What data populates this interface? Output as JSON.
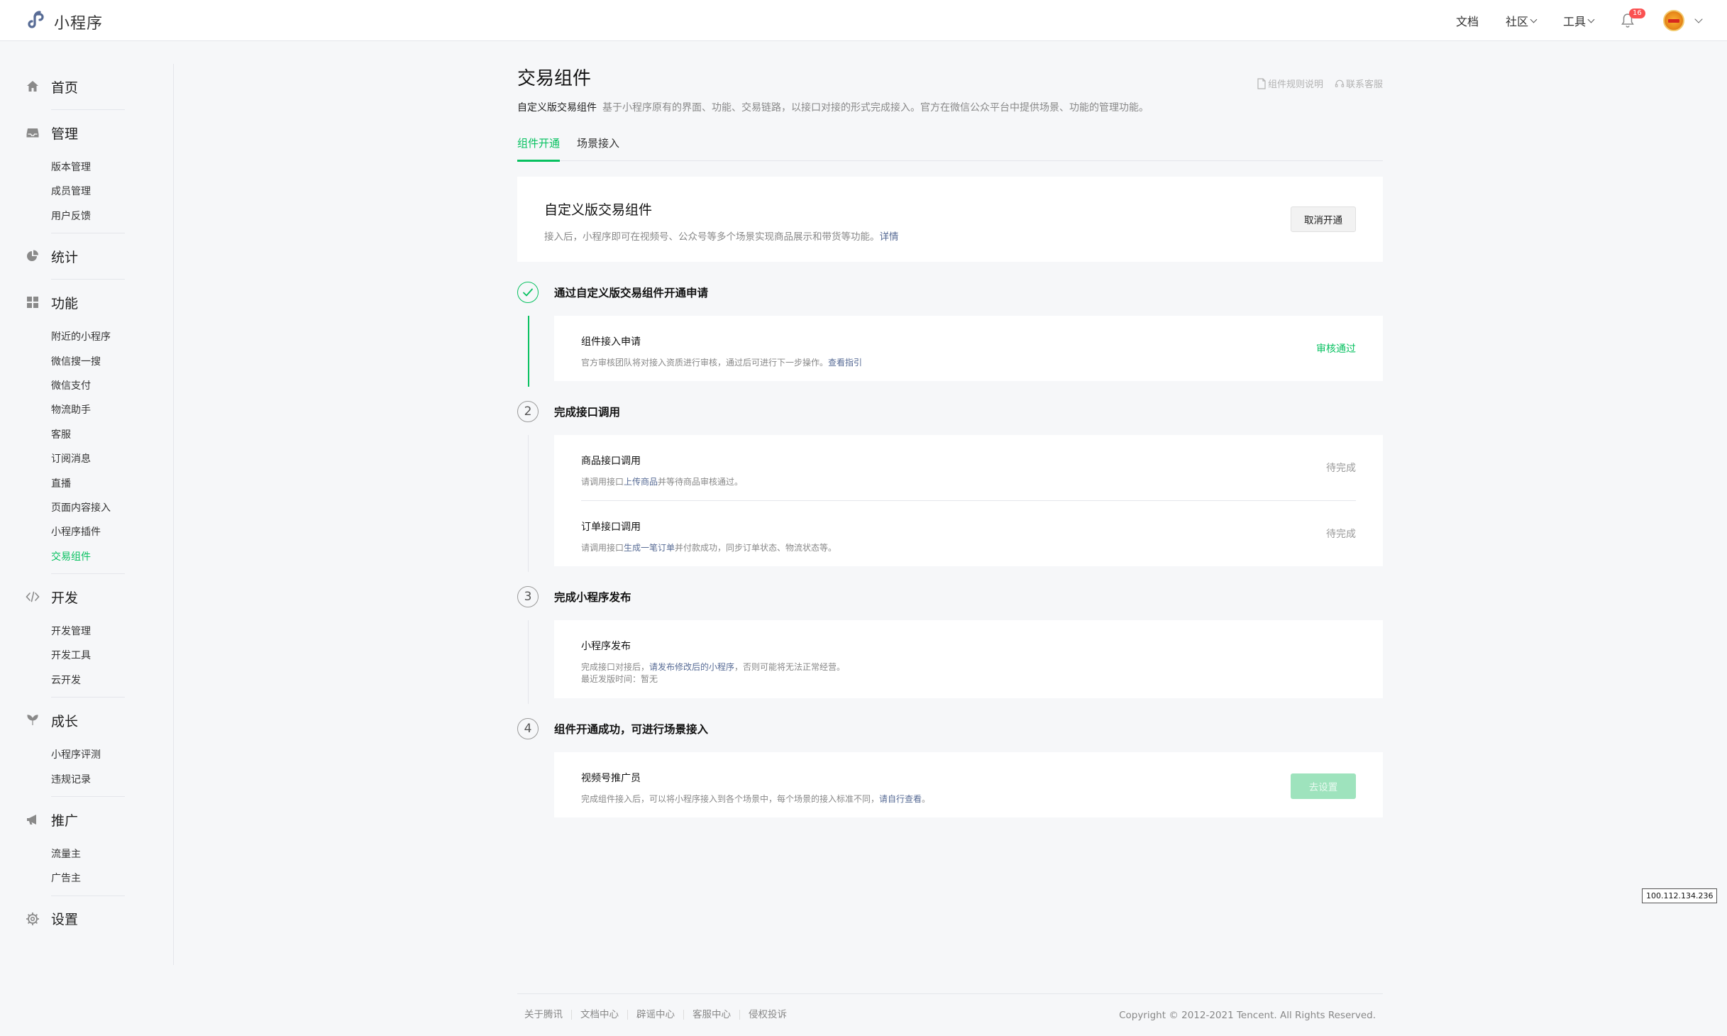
{
  "app": {
    "logo_text": "小程序",
    "brand_color": "#576b95",
    "accent_color": "#07c160"
  },
  "topnav": {
    "docs": "文档",
    "community": "社区",
    "tools": "工具",
    "notification_count": "16",
    "bell_icon": "bell-icon",
    "avatar_icon": "avatar-icon"
  },
  "sidebar": {
    "groups": [
      {
        "label": "首页",
        "icon": "home-icon",
        "items": []
      },
      {
        "label": "管理",
        "icon": "inbox-icon",
        "items": [
          "版本管理",
          "成员管理",
          "用户反馈"
        ]
      },
      {
        "label": "统计",
        "icon": "pie-chart-icon",
        "items": []
      },
      {
        "label": "功能",
        "icon": "grid-icon",
        "items": [
          "附近的小程序",
          "微信搜一搜",
          "微信支付",
          "物流助手",
          "客服",
          "订阅消息",
          "直播",
          "页面内容接入",
          "小程序插件",
          "交易组件"
        ]
      },
      {
        "label": "开发",
        "icon": "code-icon",
        "items": [
          "开发管理",
          "开发工具",
          "云开发"
        ]
      },
      {
        "label": "成长",
        "icon": "leaf-icon",
        "items": [
          "小程序评测",
          "违规记录"
        ]
      },
      {
        "label": "推广",
        "icon": "megaphone-icon",
        "items": [
          "流量主",
          "广告主"
        ]
      },
      {
        "label": "设置",
        "icon": "gear-icon",
        "items": []
      }
    ],
    "active_item": "交易组件"
  },
  "main": {
    "title": "交易组件",
    "links": {
      "rules": "组件规则说明",
      "support": "联系客服"
    },
    "subtitle_bold": "自定义版交易组件",
    "subtitle_text": "基于小程序原有的界面、功能、交易链路，以接口对接的形式完成接入。官方在微信公众平台中提供场景、功能的管理功能。",
    "tabs": [
      {
        "label": "组件开通",
        "active": true
      },
      {
        "label": "场景接入",
        "active": false
      }
    ],
    "hero": {
      "title": "自定义版交易组件",
      "desc": "接入后，小程序即可在视频号、公众号等多个场景实现商品展示和带货等功能。",
      "detail_link": "详情",
      "cancel_button": "取消开通"
    },
    "steps": [
      {
        "num": "1",
        "done": true,
        "title": "通过自定义版交易组件开通申请",
        "rows": [
          {
            "title": "组件接入申请",
            "desc_pre": "官方审核团队将对接入资质进行审核，通过后可进行下一步操作。",
            "desc_link": "查看指引",
            "desc_post": "",
            "status": "审核通过"
          }
        ]
      },
      {
        "num": "2",
        "done": false,
        "title": "完成接口调用",
        "rows": [
          {
            "title": "商品接口调用",
            "desc_pre": "请调用接口",
            "desc_link": "上传商品",
            "desc_post": "并等待商品审核通过。",
            "status": "待完成"
          },
          {
            "title": "订单接口调用",
            "desc_pre": "请调用接口",
            "desc_link": "生成一笔订单",
            "desc_post": "并付款成功，同步订单状态、物流状态等。",
            "status": "待完成"
          }
        ]
      },
      {
        "num": "3",
        "done": false,
        "title": "完成小程序发布",
        "rows": [
          {
            "title": "小程序发布",
            "desc_pre": "完成接口对接后，",
            "desc_link": "请发布修改后的小程序",
            "desc_post": "，否则可能将无法正常经营。",
            "desc_line2": "最近发版时间：暂无"
          }
        ]
      },
      {
        "num": "4",
        "done": false,
        "title": "组件开通成功，可进行场景接入",
        "rows": [
          {
            "title": "视频号推广员",
            "desc_pre": "完成组件接入后，可以将小程序接入到各个场景中，每个场景的接入标准不同，",
            "desc_link": "请自行查看",
            "desc_post": "。",
            "button": "去设置"
          }
        ]
      }
    ]
  },
  "ip_label": "100.112.134.236",
  "footer": {
    "links": [
      "关于腾讯",
      "文档中心",
      "辟谣中心",
      "客服中心",
      "侵权投诉"
    ],
    "copyright": "Copyright © 2012-2021 Tencent. All Rights Reserved."
  }
}
